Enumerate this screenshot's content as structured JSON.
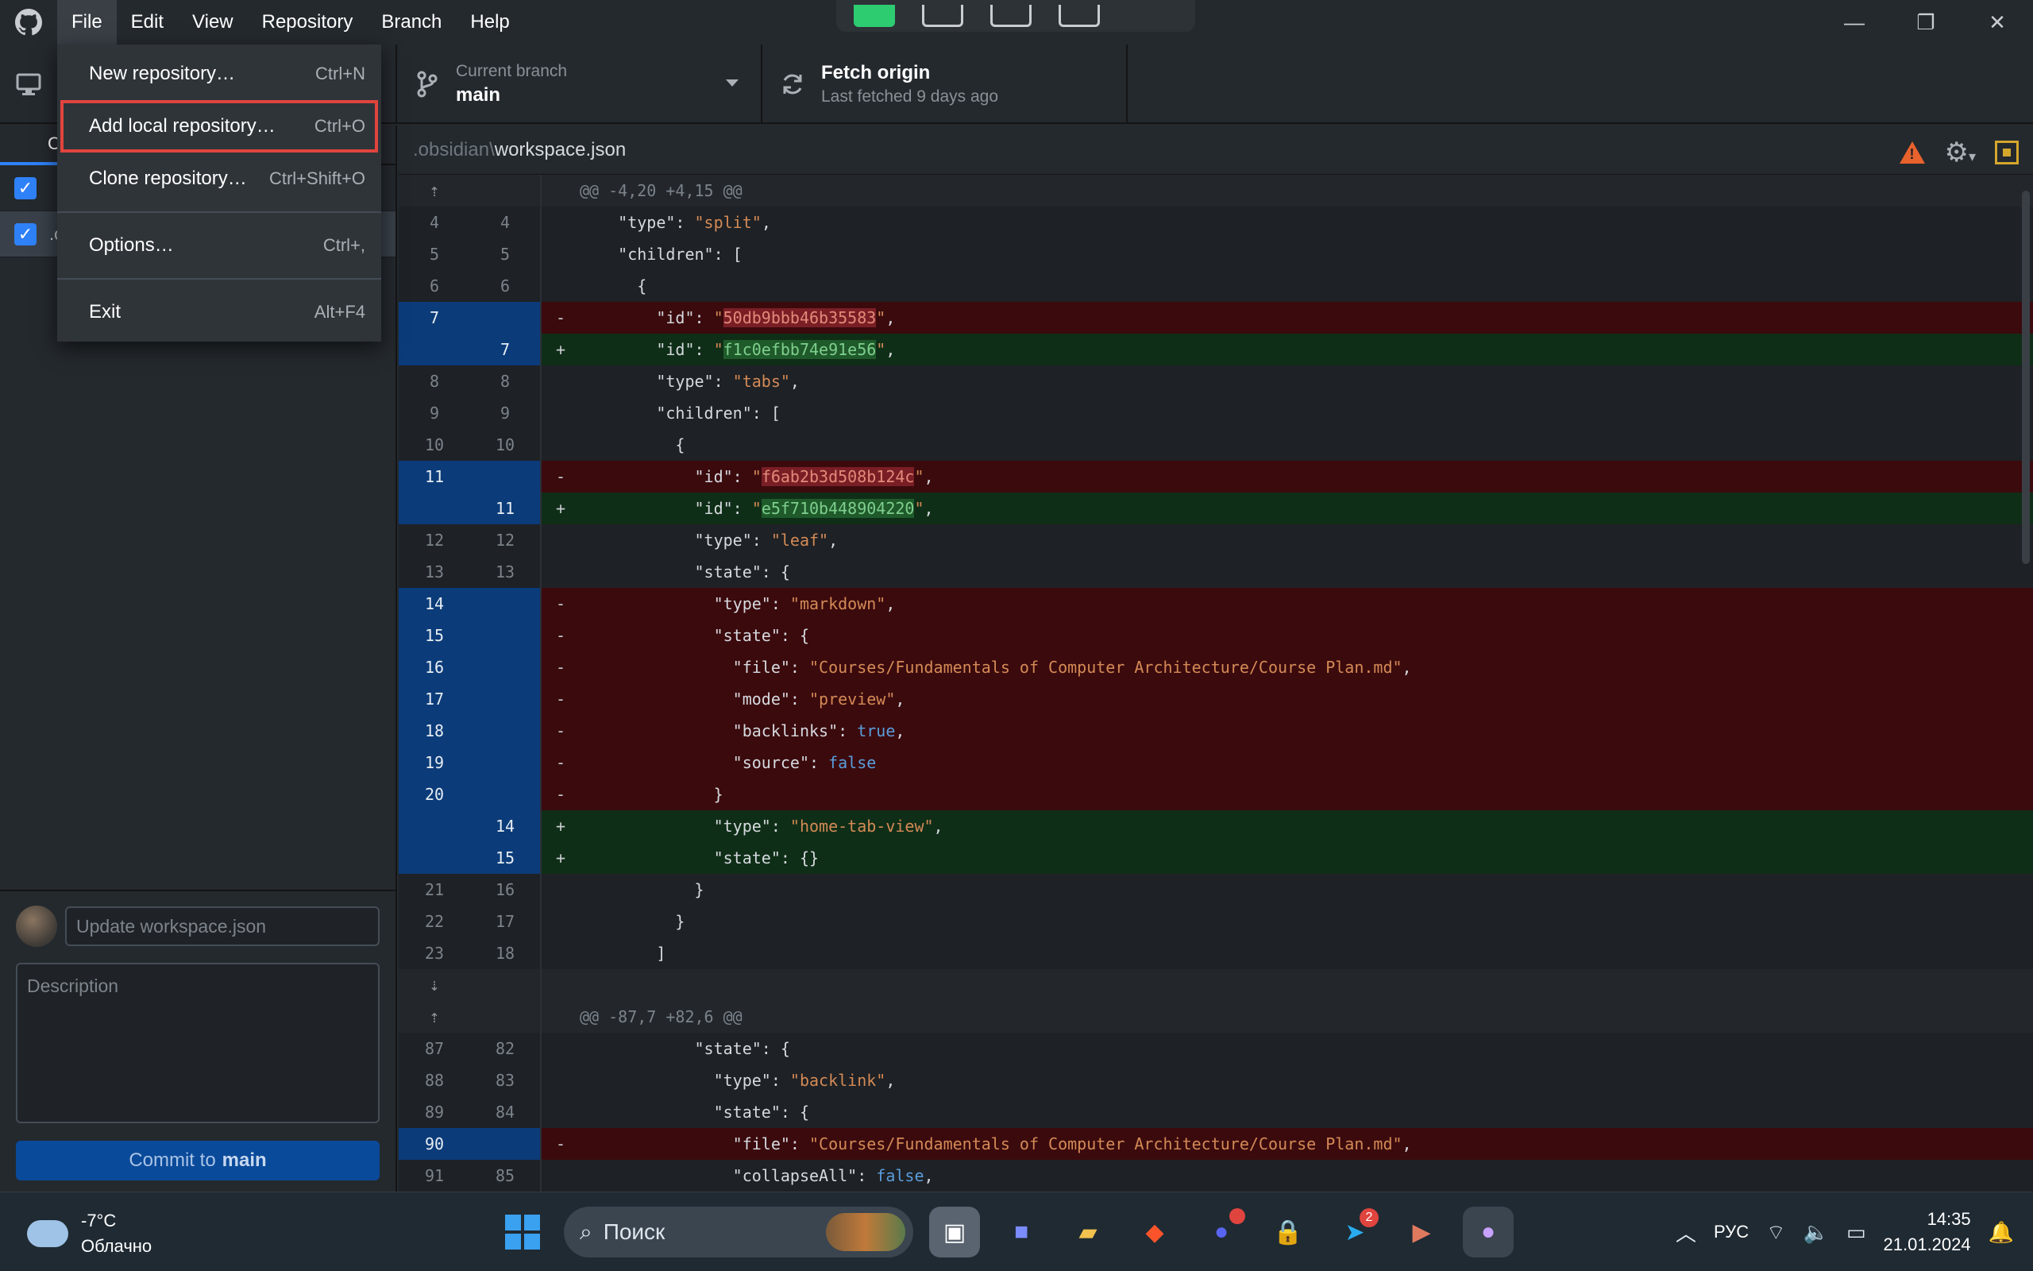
{
  "menubar": {
    "items": [
      "File",
      "Edit",
      "View",
      "Repository",
      "Branch",
      "Help"
    ]
  },
  "file_menu": {
    "items": [
      {
        "label": "New repository…",
        "shortcut": "Ctrl+N"
      },
      {
        "label": "Add local repository…",
        "shortcut": "Ctrl+O"
      },
      {
        "label": "Clone repository…",
        "shortcut": "Ctrl+Shift+O"
      },
      {
        "label": "Options…",
        "shortcut": "Ctrl+,"
      },
      {
        "label": "Exit",
        "shortcut": "Alt+F4"
      }
    ]
  },
  "toolbar": {
    "branch_label": "Current branch",
    "branch_value": "main",
    "fetch_label": "Fetch origin",
    "fetch_sub": "Last fetched 9 days ago"
  },
  "left_panel": {
    "tab_changes": "C",
    "file_partial": ".c"
  },
  "commit": {
    "summary_placeholder": "Update workspace.json",
    "description_placeholder": "Description",
    "button_prefix": "Commit to",
    "button_branch": "main"
  },
  "diff": {
    "path_dir": ".obsidian\\",
    "path_file": "workspace.json",
    "hunk1": "@@ -4,20 +4,15 @@",
    "hunk2": "@@ -87,7 +82,6 @@",
    "lines": [
      {
        "t": "ctx",
        "o": "4",
        "n": "4",
        "s": "",
        "code": "    \"type\": \"split\","
      },
      {
        "t": "ctx",
        "o": "5",
        "n": "5",
        "s": "",
        "code": "    \"children\": ["
      },
      {
        "t": "ctx",
        "o": "6",
        "n": "6",
        "s": "",
        "code": "      {"
      },
      {
        "t": "del",
        "o": "7",
        "n": "",
        "s": "-",
        "code": "        \"id\": \"50db9bbb46b35583\","
      },
      {
        "t": "add",
        "o": "",
        "n": "7",
        "s": "+",
        "code": "        \"id\": \"f1c0efbb74e91e56\","
      },
      {
        "t": "ctx",
        "o": "8",
        "n": "8",
        "s": "",
        "code": "        \"type\": \"tabs\","
      },
      {
        "t": "ctx",
        "o": "9",
        "n": "9",
        "s": "",
        "code": "        \"children\": ["
      },
      {
        "t": "ctx",
        "o": "10",
        "n": "10",
        "s": "",
        "code": "          {"
      },
      {
        "t": "del",
        "o": "11",
        "n": "",
        "s": "-",
        "code": "            \"id\": \"f6ab2b3d508b124c\","
      },
      {
        "t": "add",
        "o": "",
        "n": "11",
        "s": "+",
        "code": "            \"id\": \"e5f710b448904220\","
      },
      {
        "t": "ctx",
        "o": "12",
        "n": "12",
        "s": "",
        "code": "            \"type\": \"leaf\","
      },
      {
        "t": "ctx",
        "o": "13",
        "n": "13",
        "s": "",
        "code": "            \"state\": {"
      },
      {
        "t": "del",
        "o": "14",
        "n": "",
        "s": "-",
        "code": "              \"type\": \"markdown\","
      },
      {
        "t": "del",
        "o": "15",
        "n": "",
        "s": "-",
        "code": "              \"state\": {"
      },
      {
        "t": "del",
        "o": "16",
        "n": "",
        "s": "-",
        "code": "                \"file\": \"Courses/Fundamentals of Computer Architecture/Course Plan.md\","
      },
      {
        "t": "del",
        "o": "17",
        "n": "",
        "s": "-",
        "code": "                \"mode\": \"preview\","
      },
      {
        "t": "del",
        "o": "18",
        "n": "",
        "s": "-",
        "code": "                \"backlinks\": true,"
      },
      {
        "t": "del",
        "o": "19",
        "n": "",
        "s": "-",
        "code": "                \"source\": false"
      },
      {
        "t": "del",
        "o": "20",
        "n": "",
        "s": "-",
        "code": "              }"
      },
      {
        "t": "add",
        "o": "",
        "n": "14",
        "s": "+",
        "code": "              \"type\": \"home-tab-view\","
      },
      {
        "t": "add",
        "o": "",
        "n": "15",
        "s": "+",
        "code": "              \"state\": {}"
      },
      {
        "t": "ctx",
        "o": "21",
        "n": "16",
        "s": "",
        "code": "            }"
      },
      {
        "t": "ctx",
        "o": "22",
        "n": "17",
        "s": "",
        "code": "          }"
      },
      {
        "t": "ctx",
        "o": "23",
        "n": "18",
        "s": "",
        "code": "        ]"
      }
    ],
    "lines2": [
      {
        "t": "ctx",
        "o": "87",
        "n": "82",
        "s": "",
        "code": "            \"state\": {"
      },
      {
        "t": "ctx",
        "o": "88",
        "n": "83",
        "s": "",
        "code": "              \"type\": \"backlink\","
      },
      {
        "t": "ctx",
        "o": "89",
        "n": "84",
        "s": "",
        "code": "              \"state\": {"
      },
      {
        "t": "del",
        "o": "90",
        "n": "",
        "s": "-",
        "code": "                \"file\": \"Courses/Fundamentals of Computer Architecture/Course Plan.md\","
      },
      {
        "t": "ctx",
        "o": "91",
        "n": "85",
        "s": "",
        "code": "                \"collapseAll\": false,"
      }
    ]
  },
  "taskbar": {
    "temperature": "-7°C",
    "weather": "Облачно",
    "search_placeholder": "Поиск",
    "telegram_badge": "2",
    "language": "РУС",
    "time": "14:35",
    "date": "21.01.2024"
  }
}
